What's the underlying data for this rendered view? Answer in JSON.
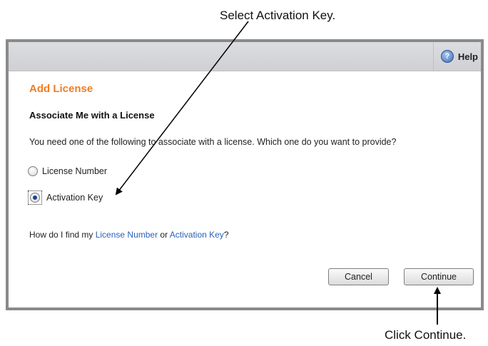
{
  "callouts": {
    "top": "Select Activation Key.",
    "bottom": "Click Continue."
  },
  "header": {
    "help_label": "Help",
    "help_icon": "help-icon"
  },
  "main": {
    "page_title": "Add License",
    "section_title": "Associate Me with a License",
    "prompt": "You need one of the following to associate with a license. Which one do you want to provide?",
    "options": [
      {
        "label": "License Number",
        "checked": false
      },
      {
        "label": "Activation Key",
        "checked": true
      }
    ],
    "help_text": {
      "prefix": "How do I find my ",
      "link1": "License Number",
      "middle": " or ",
      "link2": "Activation Key",
      "suffix": "?"
    }
  },
  "buttons": {
    "cancel": "Cancel",
    "continue": "Continue"
  },
  "colors": {
    "title_accent": "#f07d22",
    "link": "#2a62b8",
    "dialog_border": "#8a8a8a",
    "header_bg": "#d4d5d9"
  }
}
